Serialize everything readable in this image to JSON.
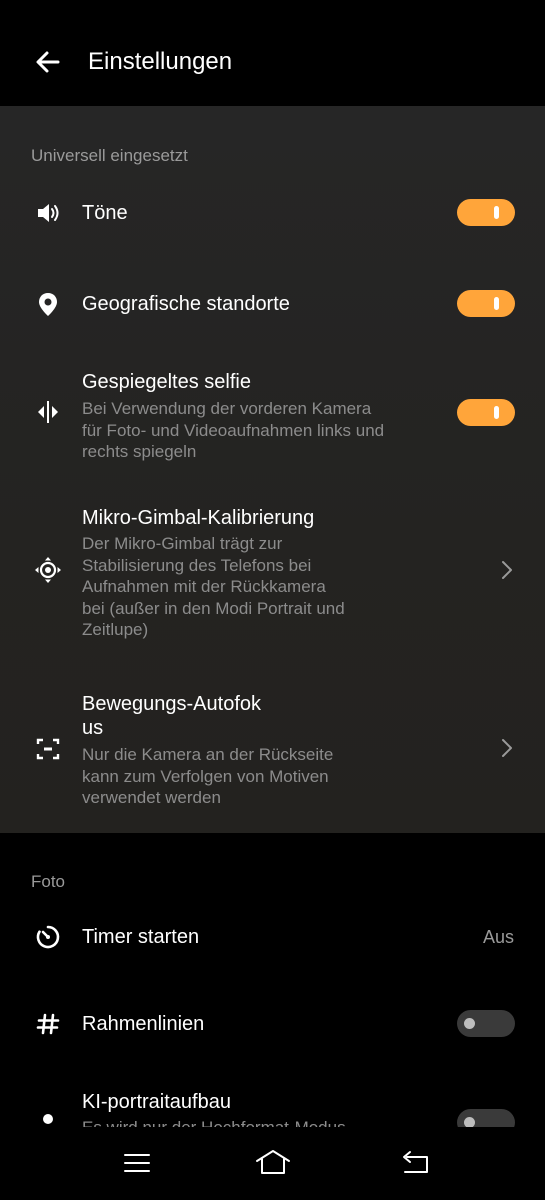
{
  "header": {
    "title": "Einstellungen",
    "back_icon": "arrow-left-icon"
  },
  "sections": {
    "universal": {
      "label": "Universell eingesetzt",
      "items": [
        {
          "label": "Töne",
          "icon": "speaker-icon",
          "toggle": true
        },
        {
          "label": "Geografische standorte",
          "icon": "location-pin-icon",
          "toggle": true
        },
        {
          "label": "Gespiegeltes selfie",
          "icon": "mirror-icon",
          "toggle": true,
          "desc": [
            "Bei Verwendung der vorderen Kamera",
            "für Foto- und Videoaufnahmen links und",
            "rechts spiegeln"
          ]
        },
        {
          "label": "Mikro-Gimbal-Kalibrierung",
          "icon": "gimbal-icon",
          "desc": [
            "Der Mikro-Gimbal trägt zur",
            "Stabilisierung des Telefons bei",
            "Aufnahmen mit der Rückkamera",
            "bei (außer in den Modi Portrait und",
            "Zeitlupe)"
          ]
        },
        {
          "label_lines": [
            "Bewegungs-Autofok",
            "us"
          ],
          "icon": "focus-frame-icon",
          "desc": [
            "Nur die Kamera an der Rückseite",
            "kann zum Verfolgen von Motiven",
            "verwendet werden"
          ]
        }
      ]
    },
    "photo": {
      "label": "Foto",
      "items": [
        {
          "label": "Timer starten",
          "icon": "timer-icon",
          "value": "Aus"
        },
        {
          "label": "Rahmenlinien",
          "icon": "grid-hash-icon",
          "toggle": false
        },
        {
          "label": "KI-portraitaufbau",
          "icon": "portrait-icon",
          "toggle": false,
          "desc": [
            "Es wird nur der Hochformat-Modus"
          ]
        }
      ]
    }
  },
  "navbar": {
    "menu_icon": "menu-icon",
    "home_icon": "home-icon",
    "back_icon": "back-return-icon"
  },
  "colors": {
    "accent": "#ffa53a",
    "panel": "#262626",
    "background": "#000000",
    "secondary_text": "#8c8c8c"
  }
}
